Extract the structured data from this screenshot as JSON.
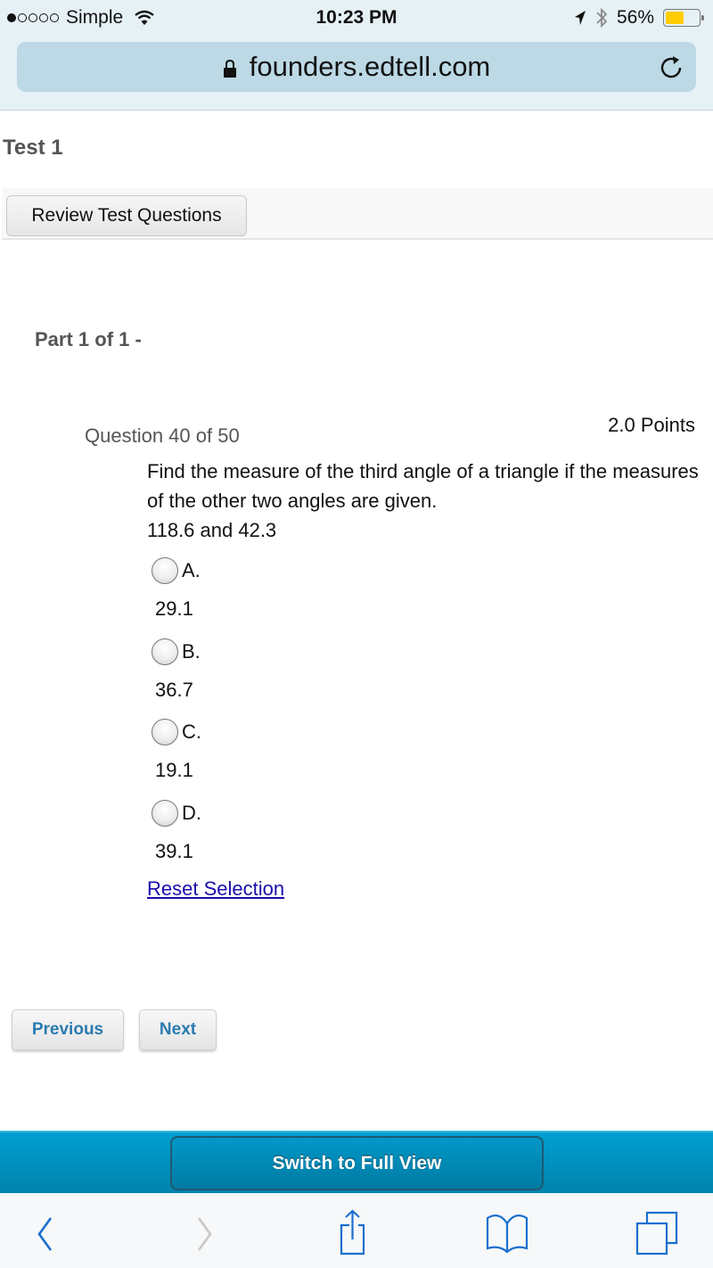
{
  "status_bar": {
    "carrier": "Simple",
    "signal_bars": 1,
    "signal_total": 5,
    "time": "10:23 PM",
    "battery_percent_label": "56%",
    "battery_level": 0.56,
    "battery_color": "#ffcc00"
  },
  "browser": {
    "url": "founders.edtell.com",
    "icons": {
      "lock": "lock-icon",
      "reload": "reload-icon"
    }
  },
  "page": {
    "title": "Test 1",
    "review_button": "Review Test Questions",
    "part_label": "Part 1 of 1 -",
    "question_number": "Question 40 of 50",
    "points": "2.0 Points",
    "question_text": "Find the measure of the third angle of a triangle if the measures of the other two angles are given.",
    "question_values": "118.6 and 42.3",
    "options": [
      {
        "letter": "A.",
        "value": "29.1",
        "selected": false
      },
      {
        "letter": "B.",
        "value": "36.7",
        "selected": false
      },
      {
        "letter": "C.",
        "value": "19.1",
        "selected": false
      },
      {
        "letter": "D.",
        "value": "39.1",
        "selected": false
      }
    ],
    "reset_link": "Reset Selection",
    "previous_button": "Previous",
    "next_button": "Next"
  },
  "switch_bar": {
    "label": "Switch to Full View"
  },
  "bottom_toolbar": {
    "items": [
      "back-icon",
      "forward-icon",
      "share-icon",
      "bookmarks-icon",
      "tabs-icon"
    ]
  },
  "colors": {
    "accent_blue": "#2a7bb0",
    "link": "#1a0dab",
    "switch_bar": "#0090c0",
    "toolbar_icon": "#1a6fcf"
  }
}
